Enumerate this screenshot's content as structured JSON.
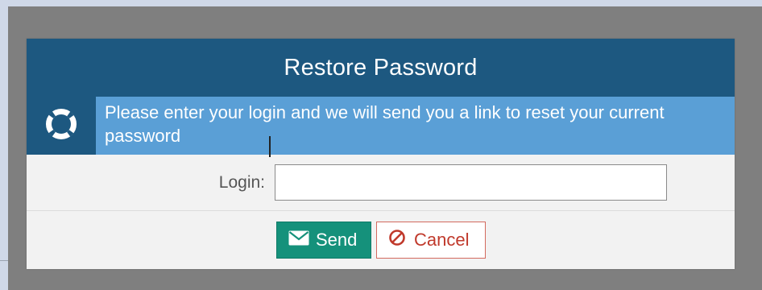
{
  "dialog": {
    "title": "Restore Password",
    "info_text": "Please enter your login and we will send you a link to reset your current password"
  },
  "form": {
    "login_label": "Login:",
    "login_value": ""
  },
  "buttons": {
    "send_label": "Send",
    "cancel_label": "Cancel"
  },
  "icons": {
    "info": "lifebuoy-icon",
    "send": "envelope-icon",
    "cancel": "ban-icon"
  },
  "colors": {
    "header": "#1d5880",
    "info_band": "#5a9fd6",
    "send_button": "#15917b",
    "cancel_text": "#c0392b"
  }
}
